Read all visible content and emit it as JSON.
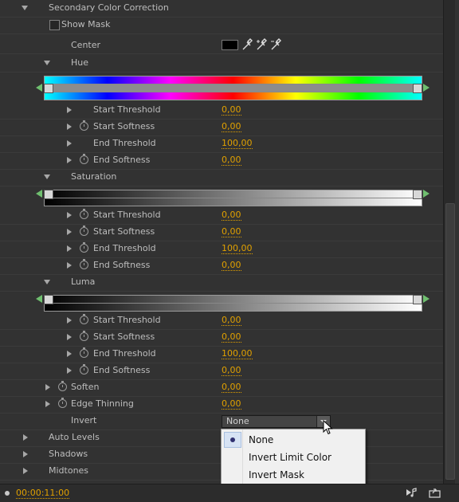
{
  "section": {
    "title": "Secondary Color Correction"
  },
  "show_mask": {
    "label": "Show Mask",
    "checked": false
  },
  "center": {
    "label": "Center",
    "swatch_color": "#000000",
    "icons": [
      "eyedropper-icon",
      "eyedropper-plus-icon",
      "eyedropper-minus-icon"
    ]
  },
  "hue": {
    "label": "Hue",
    "params": [
      {
        "label": "Start Threshold",
        "value": "0,00",
        "stopwatch": false
      },
      {
        "label": "Start Softness",
        "value": "0,00",
        "stopwatch": true
      },
      {
        "label": "End Threshold",
        "value": "100,00",
        "stopwatch": false
      },
      {
        "label": "End Softness",
        "value": "0,00",
        "stopwatch": true
      }
    ]
  },
  "saturation": {
    "label": "Saturation",
    "params": [
      {
        "label": "Start Threshold",
        "value": "0,00"
      },
      {
        "label": "Start Softness",
        "value": "0,00"
      },
      {
        "label": "End Threshold",
        "value": "100,00"
      },
      {
        "label": "End Softness",
        "value": "0,00"
      }
    ]
  },
  "luma": {
    "label": "Luma",
    "params": [
      {
        "label": "Start Threshold",
        "value": "0,00"
      },
      {
        "label": "Start Softness",
        "value": "0,00"
      },
      {
        "label": "End Threshold",
        "value": "100,00"
      },
      {
        "label": "End Softness",
        "value": "0,00"
      }
    ]
  },
  "soften": {
    "label": "Soften",
    "value": "0,00"
  },
  "edge_thinning": {
    "label": "Edge Thinning",
    "value": "0,00"
  },
  "invert": {
    "label": "Invert",
    "selected": "None",
    "options": [
      {
        "label": "None",
        "selected": true
      },
      {
        "label": "Invert Limit Color",
        "selected": false
      },
      {
        "label": "Invert Mask",
        "selected": false
      }
    ]
  },
  "other_sections": [
    {
      "label": "Auto Levels"
    },
    {
      "label": "Shadows"
    },
    {
      "label": "Midtones"
    }
  ],
  "footer": {
    "timecode": "00:00:11:00"
  },
  "colors": {
    "value_accent": "#e0a000",
    "panel_bg": "#323232"
  }
}
